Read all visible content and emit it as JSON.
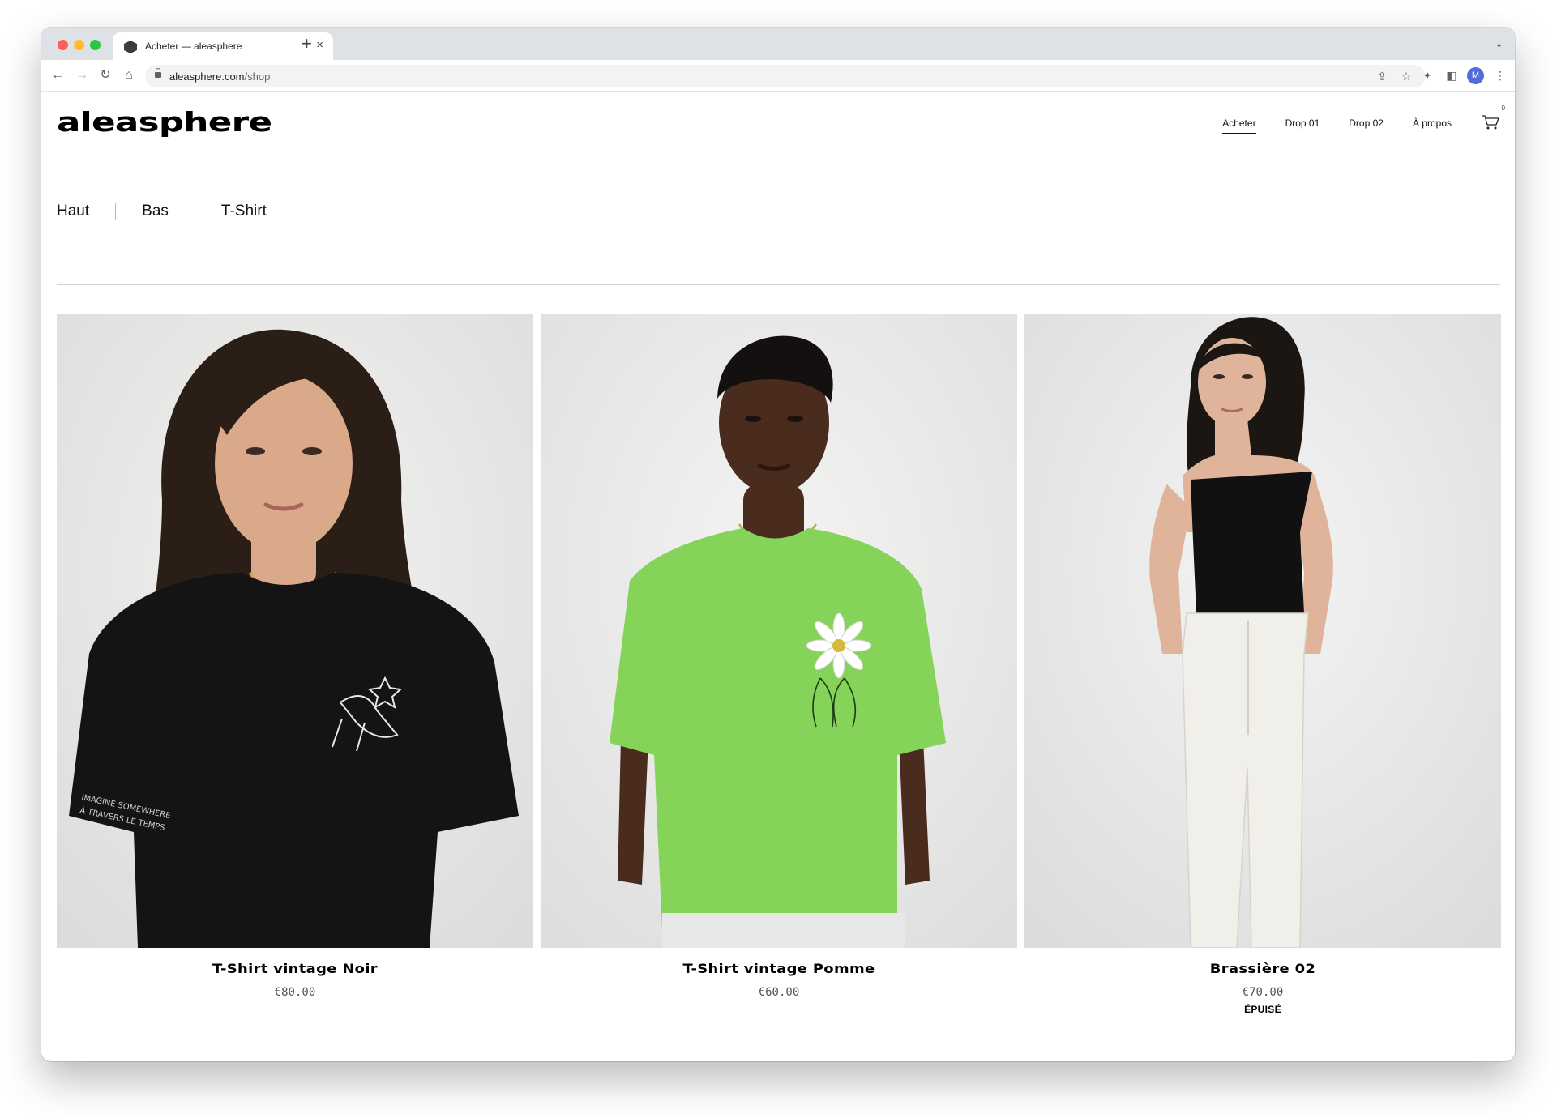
{
  "browser": {
    "tab_title": "Acheter — aleasphere",
    "tab_close": "×",
    "new_tab": "+",
    "tabs_menu": "⌄",
    "url_host": "aleasphere.com",
    "url_path": "/shop",
    "profile_initial": "M"
  },
  "site": {
    "logo": "aleasphere",
    "nav": [
      {
        "label": "Acheter",
        "active": true
      },
      {
        "label": "Drop 01",
        "active": false
      },
      {
        "label": "Drop 02",
        "active": false
      },
      {
        "label": "À propos",
        "active": false
      }
    ],
    "cart_count": "0"
  },
  "categories": [
    "Haut",
    "Bas",
    "T-Shirt"
  ],
  "products": [
    {
      "name": "T-Shirt vintage Noir",
      "price": "€80.00",
      "badge": "",
      "garment_color": "#141414",
      "skin": "#d9a98a",
      "hair": "#2a1e17"
    },
    {
      "name": "T-Shirt vintage Pomme",
      "price": "€60.00",
      "badge": "",
      "garment_color": "#86d35a",
      "skin": "#4a2c1f",
      "hair": "#141010"
    },
    {
      "name": "Brassière 02",
      "price": "€70.00",
      "badge": "ÉPUISÉ",
      "garment_color": "#111111",
      "skin": "#e0b49a",
      "hair": "#1c1612"
    }
  ]
}
